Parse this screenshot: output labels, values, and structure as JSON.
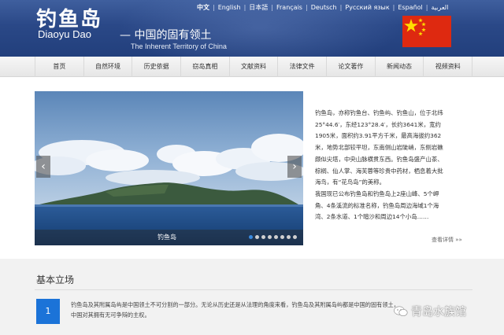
{
  "header": {
    "title_cn": "钓鱼岛",
    "title_en": "Diaoyu Dao",
    "tagline_cn": "— 中国的固有领土",
    "tagline_en": "The Inherent Territory of China",
    "languages": [
      "中文",
      "English",
      "日本語",
      "Français",
      "Deutsch",
      "Русский язык",
      "Español",
      "العربية"
    ],
    "flag_icon": "china-flag-icon"
  },
  "nav": {
    "items": [
      "首页",
      "自然环境",
      "历史依据",
      "窃岛真相",
      "文献资料",
      "法律文件",
      "论文著作",
      "新闻动态",
      "视频资料"
    ]
  },
  "slider": {
    "caption": "钓鱼岛",
    "prev_icon": "‹",
    "next_icon": "›",
    "dot_count": 8,
    "active_dot": 0
  },
  "description": {
    "lines": [
      "钓鱼岛，亦称钓鱼台、钓鱼屿、钓鱼山，位于北纬",
      "25°44.6′，东经123°28.4′，长约3641米，宽约",
      "1905米，面积约3.91平方千米，最高海拔约362",
      "米，地势北部较平坦，东南侧山岩陡峭，东侧岩礁",
      "颇似尖塔，中央山脉横贯东西。钓鱼岛盛产山茶、",
      "棕榈、仙人掌、海芙蓉等珍贵中药材，栖息着大批",
      "海鸟，有“花鸟岛”的美称。",
      "我国现已公布钓鱼岛和钓鱼岛上2座山峰、5个岬",
      "角、4条溪流的标准名称，钓鱼岛周边海域1个海",
      "湾、2条水道、1个暗沙和周边14个小岛……"
    ],
    "more_label": "查看详情 »»"
  },
  "basic_position": {
    "title": "基本立场",
    "number": "1",
    "text_line1": "钓鱼岛及其附属岛屿是中国领土不可分割的一部分。无论从历史还是从法理的角度来看，钓鱼岛及其附属岛屿都是中国的固有领土，",
    "text_line2": "中国对其拥有无可争辩的主权。"
  },
  "watermark": {
    "text": "青岛水族馆",
    "icon": "wechat-icon"
  },
  "colors": {
    "header_blue": "#2a4887",
    "accent_blue": "#1b73d8",
    "flag_red": "#de2910",
    "flag_yellow": "#ffde00"
  }
}
